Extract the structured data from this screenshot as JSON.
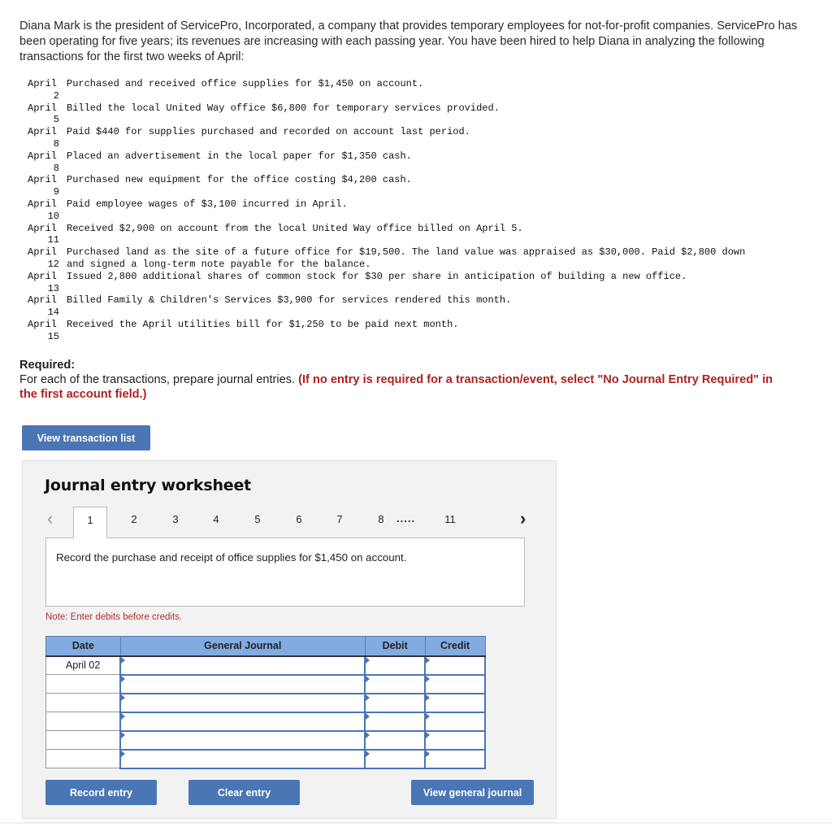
{
  "intro": "Diana Mark is the president of ServicePro, Incorporated, a company that provides temporary employees for not-for-profit companies. ServicePro has been operating for five years; its revenues are increasing with each passing year. You have been hired to help Diana in analyzing the following transactions for the first two weeks of April:",
  "transactions": [
    {
      "month": "April",
      "day": "2",
      "desc": "Purchased and received office supplies for $1,450 on account."
    },
    {
      "month": "April",
      "day": "5",
      "desc": "Billed the local United Way office $6,800 for temporary services provided."
    },
    {
      "month": "April",
      "day": "8",
      "desc": "Paid $440 for supplies purchased and recorded on account last period."
    },
    {
      "month": "April",
      "day": "8",
      "desc": "Placed an advertisement in the local paper for $1,350 cash."
    },
    {
      "month": "April",
      "day": "9",
      "desc": "Purchased new equipment for the office costing $4,200 cash."
    },
    {
      "month": "April",
      "day": "10",
      "desc": "Paid employee wages of $3,100 incurred in April."
    },
    {
      "month": "April",
      "day": "11",
      "desc": "Received $2,900 on account from the local United Way office billed on April 5."
    },
    {
      "month": "April",
      "day": "12",
      "desc": "Purchased land as the site of a future office for $19,500. The land value was appraised as $30,000. Paid $2,800 down and signed a long-term note payable for the balance."
    },
    {
      "month": "April",
      "day": "13",
      "desc": "Issued 2,800 additional shares of common stock for $30 per share in anticipation of building a new office."
    },
    {
      "month": "April",
      "day": "14",
      "desc": "Billed Family & Children's Services $3,900 for services rendered this month."
    },
    {
      "month": "April",
      "day": "15",
      "desc": "Received the April utilities bill for $1,250 to be paid next month."
    }
  ],
  "required": {
    "label": "Required:",
    "text": "For each of the transactions, prepare journal entries. ",
    "emphasis": "(If no entry is required for a transaction/event, select \"No Journal Entry Required\" in the first account field.)"
  },
  "buttons": {
    "view_transaction_list": "View transaction list",
    "record_entry": "Record entry",
    "clear_entry": "Clear entry",
    "view_general_journal": "View general journal"
  },
  "worksheet": {
    "title": "Journal entry worksheet",
    "prev_icon": "‹",
    "next_icon": "›",
    "tabs": [
      "1",
      "2",
      "3",
      "4",
      "5",
      "6",
      "7",
      "8",
      "11"
    ],
    "active_tab": "1",
    "ellipsis": ".....",
    "description": "Record the purchase and receipt of office supplies for $1,450 on account.",
    "note": "Note: Enter debits before credits.",
    "table": {
      "headers": [
        "Date",
        "General Journal",
        "Debit",
        "Credit"
      ],
      "rows": [
        {
          "date": "April 02",
          "account": "",
          "debit": "",
          "credit": ""
        },
        {
          "date": "",
          "account": "",
          "debit": "",
          "credit": ""
        },
        {
          "date": "",
          "account": "",
          "debit": "",
          "credit": ""
        },
        {
          "date": "",
          "account": "",
          "debit": "",
          "credit": ""
        },
        {
          "date": "",
          "account": "",
          "debit": "",
          "credit": ""
        },
        {
          "date": "",
          "account": "",
          "debit": "",
          "credit": ""
        }
      ]
    }
  },
  "colors": {
    "button": "#4a76b5",
    "header": "#82abe0",
    "emphasis_red": "#b01f1f",
    "panel": "#f2f2f2"
  }
}
